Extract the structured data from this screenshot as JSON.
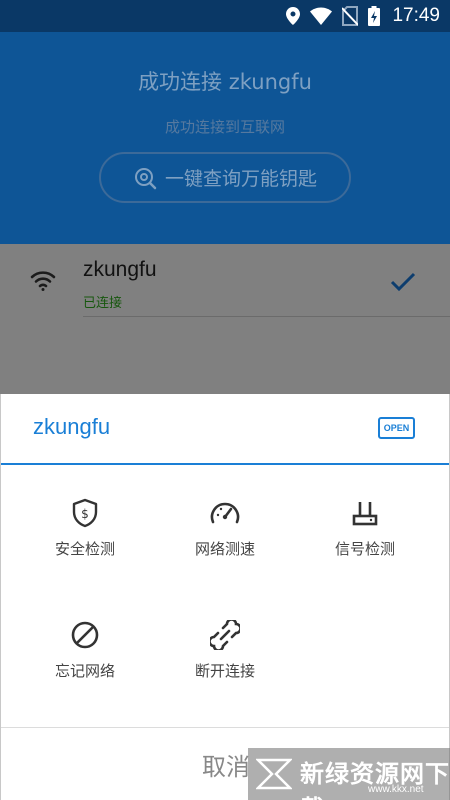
{
  "status_bar": {
    "time": "17:49",
    "icons": [
      "location-icon",
      "wifi-full-icon",
      "no-sim-icon",
      "battery-charging-icon"
    ]
  },
  "header": {
    "title": "成功连接 zkungfu",
    "subtitle": "成功连接到互联网",
    "query_button_label": "一键查询万能钥匙",
    "query_icon": "key-search-icon"
  },
  "network": {
    "name": "zkungfu",
    "status": "已连接",
    "signal_icon": "wifi-signal-icon",
    "connected_icon": "check-icon"
  },
  "sheet": {
    "title": "zkungfu",
    "badge": "OPEN",
    "actions": [
      {
        "label": "安全检测",
        "icon": "shield-dollar-icon"
      },
      {
        "label": "网络测速",
        "icon": "speedometer-icon"
      },
      {
        "label": "信号检测",
        "icon": "router-icon"
      },
      {
        "label": "忘记网络",
        "icon": "forbidden-icon"
      },
      {
        "label": "断开连接",
        "icon": "broken-link-icon"
      }
    ],
    "cancel_label": "取消"
  },
  "watermark": {
    "text": "新绿资源网下载",
    "url": "www.kkx.net"
  },
  "colors": {
    "header_bg": "#0e5596",
    "accent": "#1a7fd6",
    "overlay": "#808080",
    "connected_text": "#17570e"
  }
}
